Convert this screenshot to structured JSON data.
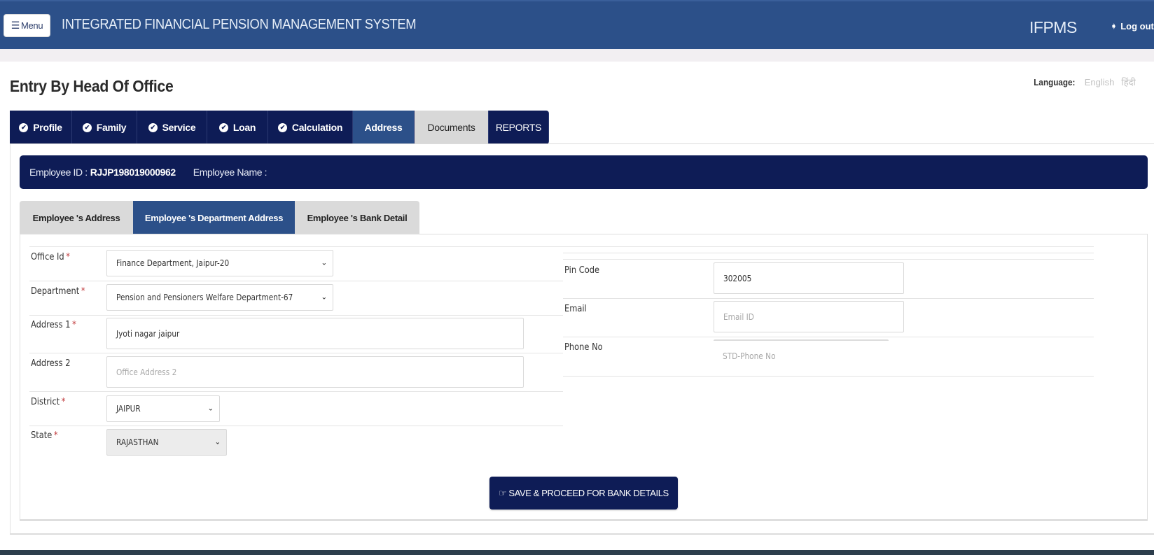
{
  "header": {
    "menu_label": "Menu",
    "app_title": "INTEGRATED FINANCIAL PENSION MANAGEMENT SYSTEM",
    "brand": "IFPMS",
    "logout_label": "Log out"
  },
  "page": {
    "title": "Entry By Head Of Office",
    "language_label": "Language:",
    "language_options": [
      "English",
      "हिंदी"
    ]
  },
  "main_tabs": [
    {
      "label": "Profile",
      "checked": true
    },
    {
      "label": "Family",
      "checked": true
    },
    {
      "label": "Service",
      "checked": true
    },
    {
      "label": "Loan",
      "checked": true
    },
    {
      "label": "Calculation",
      "checked": true
    },
    {
      "label": "Address",
      "checked": false,
      "active": true
    },
    {
      "label": "Documents",
      "checked": false
    },
    {
      "label": "REPORTS",
      "checked": false
    }
  ],
  "employee": {
    "id_label": "Employee ID :",
    "id_value": "RJJP198019000962",
    "name_label": "Employee Name :",
    "name_value": ""
  },
  "sub_tabs": [
    {
      "label": "Employee 's Address"
    },
    {
      "label": "Employee 's Department Address",
      "active": true
    },
    {
      "label": "Employee 's Bank Detail"
    }
  ],
  "form": {
    "office_id": {
      "label": "Office Id",
      "required": true,
      "value": "Finance Department, Jaipur-20"
    },
    "department": {
      "label": "Department",
      "required": true,
      "value": "Pension and Pensioners Welfare Department-67"
    },
    "address1": {
      "label": "Address 1",
      "required": true,
      "value": "Jyoti nagar jaipur"
    },
    "address2": {
      "label": "Address 2",
      "required": false,
      "value": "",
      "placeholder": "Office Address 2"
    },
    "district": {
      "label": "District",
      "required": true,
      "value": "JAIPUR"
    },
    "state": {
      "label": "State",
      "required": true,
      "value": "RAJASTHAN"
    },
    "pin_code": {
      "label": "Pin Code",
      "value": "302005"
    },
    "email": {
      "label": "Email",
      "value": "",
      "placeholder": "Email ID"
    },
    "phone": {
      "label": "Phone No",
      "value": "",
      "placeholder": "STD-Phone No"
    },
    "required_marker": "*"
  },
  "actions": {
    "save_label": "SAVE & PROCEED FOR BANK DETAILS"
  },
  "icons": {
    "menu": "☰",
    "logout": "➧",
    "check": "✔",
    "chevron": "⌄",
    "hand": "☞"
  }
}
